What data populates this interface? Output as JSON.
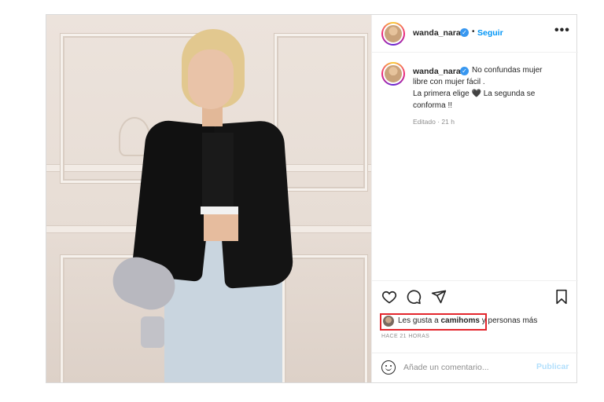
{
  "post": {
    "username": "wanda_nara",
    "verified": true,
    "separator": "•",
    "follow_label": "Seguir",
    "more_label": "•••",
    "caption": {
      "line1": "No confundas mujer",
      "line2": "libre con mujer fácil .",
      "line3a": "La primera elige",
      "line3b": "La segunda se",
      "line4": "conforma !!",
      "heart": "🖤"
    },
    "edited": "Editado · 21 h",
    "likes": {
      "prefix": "Les gusta a",
      "user": "camihoms",
      "suffix": "y personas más"
    },
    "time": "HACE 21 HORAS",
    "comment_placeholder": "Añade un comentario...",
    "publish_label": "Publicar"
  },
  "colors": {
    "accent": "#0095f6",
    "highlight_box": "#e3262d",
    "muted": "#8e8e8e",
    "publish_disabled": "#b2dffc"
  },
  "icons": [
    "heart-icon",
    "comment-icon",
    "share-icon",
    "bookmark-icon",
    "emoji-icon",
    "verified-badge-icon",
    "more-icon"
  ]
}
